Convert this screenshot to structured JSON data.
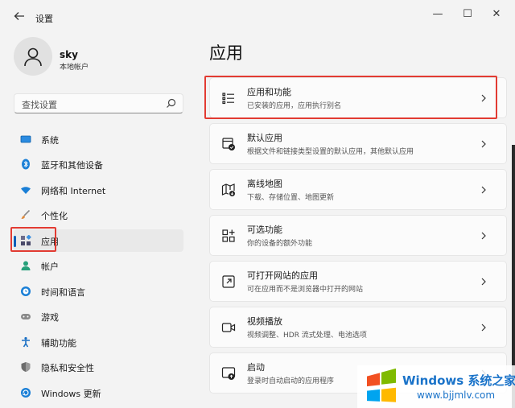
{
  "window": {
    "title": "设置",
    "controls": {
      "minimize": "—",
      "maximize": "☐",
      "close": "✕"
    }
  },
  "profile": {
    "name": "sky",
    "account_type": "本地帐户"
  },
  "search": {
    "placeholder": "查找设置"
  },
  "sidebar": {
    "items": [
      {
        "label": "系统",
        "icon": "system-icon",
        "color": "#0078d4"
      },
      {
        "label": "蓝牙和其他设备",
        "icon": "bluetooth-icon",
        "color": "#0078d4"
      },
      {
        "label": "网络和 Internet",
        "icon": "wifi-icon",
        "color": "#0078d4"
      },
      {
        "label": "个性化",
        "icon": "brush-icon",
        "color": "#d87a37"
      },
      {
        "label": "应用",
        "icon": "apps-icon",
        "color": "#5a5a7a",
        "active": true
      },
      {
        "label": "帐户",
        "icon": "person-icon",
        "color": "#2aa37a"
      },
      {
        "label": "时间和语言",
        "icon": "globe-clock-icon",
        "color": "#0078d4"
      },
      {
        "label": "游戏",
        "icon": "gamepad-icon",
        "color": "#7a7a7a"
      },
      {
        "label": "辅助功能",
        "icon": "accessibility-icon",
        "color": "#1a6fc4"
      },
      {
        "label": "隐私和安全性",
        "icon": "shield-icon",
        "color": "#6a6a6a"
      },
      {
        "label": "Windows 更新",
        "icon": "update-icon",
        "color": "#0078d4"
      }
    ]
  },
  "main": {
    "title": "应用",
    "cards": [
      {
        "title": "应用和功能",
        "desc": "已安装的应用，应用执行别名",
        "icon": "list-icon"
      },
      {
        "title": "默认应用",
        "desc": "根据文件和链接类型设置的默认应用，其他默认应用",
        "icon": "default-apps-icon"
      },
      {
        "title": "离线地图",
        "desc": "下载、存储位置、地图更新",
        "icon": "map-icon"
      },
      {
        "title": "可选功能",
        "desc": "你的设备的额外功能",
        "icon": "optional-features-icon"
      },
      {
        "title": "可打开网站的应用",
        "desc": "可在应用而不是浏览器中打开的网站",
        "icon": "open-in-app-icon"
      },
      {
        "title": "视频播放",
        "desc": "视频调整、HDR 流式处理、电池选项",
        "icon": "video-icon"
      },
      {
        "title": "启动",
        "desc": "登录时自动启动的应用程序",
        "icon": "startup-icon"
      }
    ]
  },
  "watermark": {
    "line1": "Windows 系统之家",
    "line2": "www.bjjmlv.com"
  },
  "colors": {
    "accent": "#005fb8",
    "highlight_box": "#e23b32",
    "watermark": "#1a73c9"
  }
}
